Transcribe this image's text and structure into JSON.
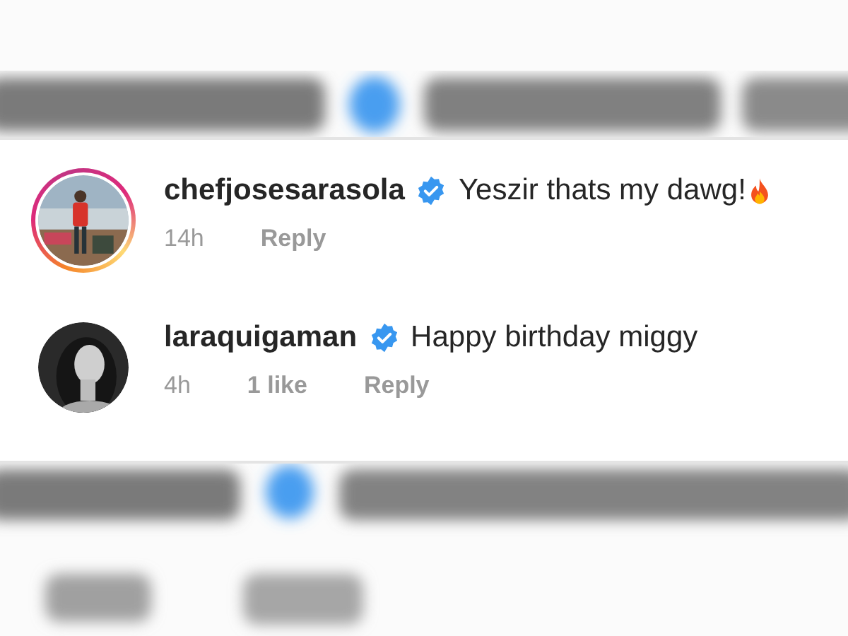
{
  "comments": [
    {
      "username": "chefjosesarasola",
      "verified": true,
      "text": "Yeszir thats my dawg!",
      "fire_emoji": true,
      "story_ring": true,
      "time": "14h",
      "reply": "Reply"
    },
    {
      "username": "laraquigaman",
      "verified": true,
      "text": "Happy birthday miggy",
      "story_ring": false,
      "time": "4h",
      "likes": "1 like",
      "reply": "Reply"
    }
  ]
}
